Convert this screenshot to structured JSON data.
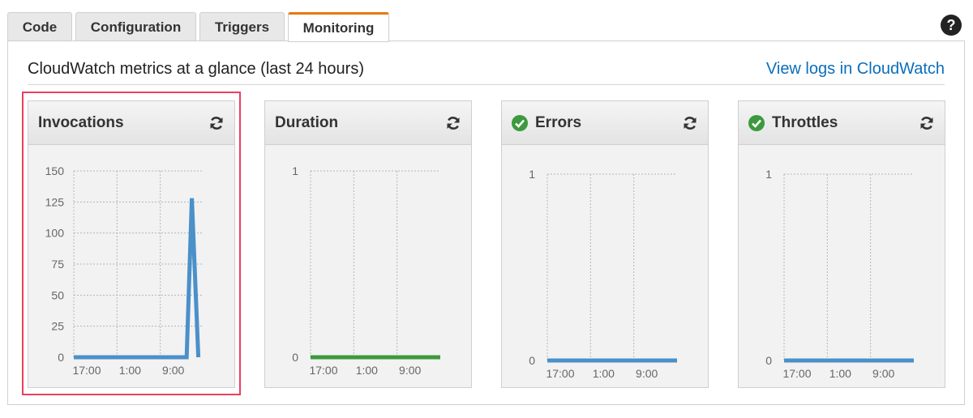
{
  "tabs": [
    {
      "label": "Code",
      "active": false
    },
    {
      "label": "Configuration",
      "active": false
    },
    {
      "label": "Triggers",
      "active": false
    },
    {
      "label": "Monitoring",
      "active": true
    }
  ],
  "help_icon": "question-circle-icon",
  "header": {
    "title": "CloudWatch metrics at a glance (last 24 hours)",
    "link": "View logs in CloudWatch"
  },
  "colors": {
    "accent_tab": "#e47911",
    "link": "#0a6ebd",
    "line_blue": "#4a90c9",
    "line_green": "#3c9a3c",
    "status_ok": "#3c9a3c",
    "highlight": "#e8405f"
  },
  "cards": [
    {
      "title": "Invocations",
      "status_icon": "",
      "refresh_icon": "refresh-icon",
      "highlighted": true
    },
    {
      "title": "Duration",
      "status_icon": "",
      "refresh_icon": "refresh-icon",
      "highlighted": false
    },
    {
      "title": "Errors",
      "status_icon": "check-circle-icon",
      "refresh_icon": "refresh-icon",
      "highlighted": false
    },
    {
      "title": "Throttles",
      "status_icon": "check-circle-icon",
      "refresh_icon": "refresh-icon",
      "highlighted": false
    }
  ],
  "chart_data": [
    {
      "type": "line",
      "title": "Invocations",
      "x": [
        "17:00",
        "1:00",
        "9:00"
      ],
      "y_ticks": [
        0,
        25,
        50,
        75,
        100,
        125,
        150
      ],
      "ylim": [
        0,
        150
      ],
      "grid": true,
      "series": [
        {
          "color": "#4a90c9",
          "points": [
            [
              0,
              0
            ],
            [
              0.87,
              0
            ],
            [
              0.91,
              128
            ],
            [
              0.96,
              0
            ]
          ]
        }
      ]
    },
    {
      "type": "line",
      "title": "Duration",
      "x": [
        "17:00",
        "1:00",
        "9:00"
      ],
      "y_ticks": [
        0,
        1
      ],
      "ylim": [
        0,
        1
      ],
      "grid": true,
      "series": [
        {
          "color": "#3c9a3c",
          "points": [
            [
              0,
              0
            ],
            [
              1,
              0
            ]
          ]
        }
      ]
    },
    {
      "type": "line",
      "title": "Errors",
      "x": [
        "17:00",
        "1:00",
        "9:00"
      ],
      "y_ticks": [
        0,
        1
      ],
      "ylim": [
        0,
        1
      ],
      "grid": true,
      "series": [
        {
          "color": "#4a90c9",
          "points": [
            [
              0,
              0
            ],
            [
              1,
              0
            ]
          ]
        }
      ]
    },
    {
      "type": "line",
      "title": "Throttles",
      "x": [
        "17:00",
        "1:00",
        "9:00"
      ],
      "y_ticks": [
        0,
        1
      ],
      "ylim": [
        0,
        1
      ],
      "grid": true,
      "series": [
        {
          "color": "#4a90c9",
          "points": [
            [
              0,
              0
            ],
            [
              1,
              0
            ]
          ]
        }
      ]
    }
  ]
}
